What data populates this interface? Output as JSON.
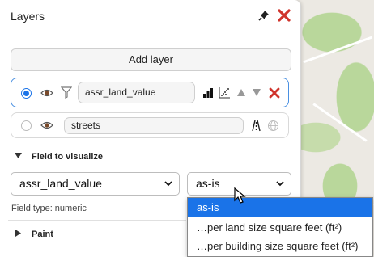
{
  "panel": {
    "title": "Layers",
    "add_layer_label": "Add layer"
  },
  "layers": [
    {
      "name": "assr_land_value",
      "selected": true
    },
    {
      "name": "streets",
      "selected": false
    }
  ],
  "field_section": {
    "label": "Field to visualize",
    "field_select_value": "assr_land_value",
    "transform_select_value": "as-is",
    "field_type_text": "Field type: numeric"
  },
  "paint_section": {
    "label": "Paint"
  },
  "transform_options": [
    "as-is",
    "…per land size square feet (ft²)",
    "…per building size square feet (ft²)"
  ],
  "colors": {
    "accent": "#1a73e8",
    "close_red": "#d0342c",
    "active_border": "#4a90e2"
  },
  "icons": [
    "pin-icon",
    "close-icon",
    "eye-icon",
    "filter-icon",
    "bar-chart-icon",
    "scatter-icon",
    "arrow-up-icon",
    "arrow-down-icon",
    "remove-icon",
    "style-icon",
    "globe-icon",
    "chevron-down-icon",
    "cursor-icon"
  ]
}
